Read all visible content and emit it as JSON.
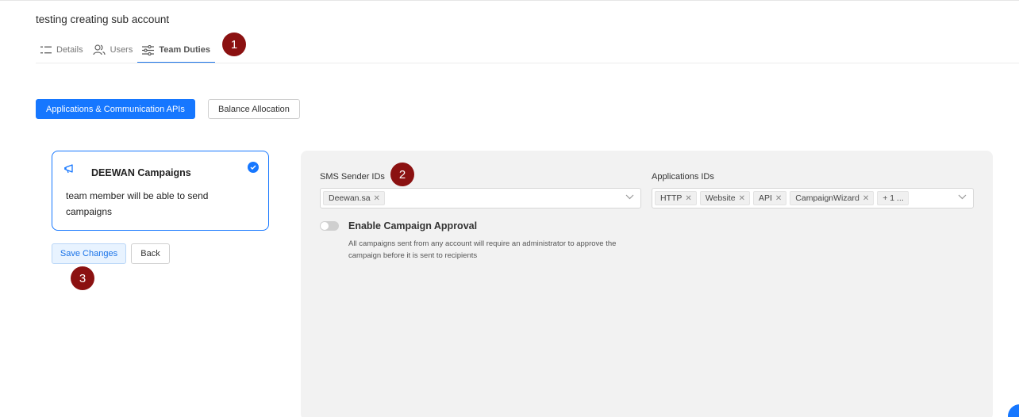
{
  "page": {
    "title": "testing creating sub account"
  },
  "tabs": [
    {
      "label": "Details",
      "icon": "list-icon"
    },
    {
      "label": "Users",
      "icon": "users-icon"
    },
    {
      "label": "Team Duties",
      "icon": "sliders-icon",
      "active": true
    }
  ],
  "markers": [
    "1",
    "2",
    "3"
  ],
  "subtabs": {
    "primary": "Applications & Communication APIs",
    "secondary": "Balance Allocation"
  },
  "card": {
    "title": "DEEWAN Campaigns",
    "description": "team member will be able to send campaigns",
    "icon": "megaphone-icon",
    "selected": true
  },
  "actions": {
    "save": "Save Changes",
    "back": "Back"
  },
  "panel": {
    "sms_sender_ids": {
      "label": "SMS Sender IDs",
      "tags": [
        "Deewan.sa"
      ]
    },
    "applications_ids": {
      "label": "Applications IDs",
      "tags": [
        "HTTP",
        "Website",
        "API",
        "CampaignWizard"
      ],
      "more": "+ 1 ..."
    },
    "campaign_approval": {
      "label": "Enable Campaign Approval",
      "description": "All campaigns sent from any account will require an administrator to approve the campaign before it is sent to recipients",
      "enabled": false
    }
  },
  "colors": {
    "accent": "#1677ff",
    "marker": "#8b1111",
    "panel_bg": "#f2f2f2"
  }
}
